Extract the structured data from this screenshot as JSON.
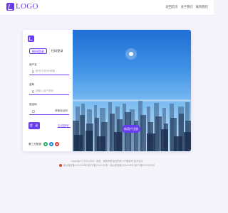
{
  "brand": {
    "logo_text": "LOGO",
    "accent": "#6a3cf0"
  },
  "topnav": {
    "items": [
      "返回首页",
      "关于我们",
      "联系我们"
    ]
  },
  "login": {
    "tabs": [
      {
        "label": "密码登录",
        "active": true
      },
      {
        "label": "扫码登录",
        "active": false
      }
    ],
    "username": {
      "label": "用户名",
      "placeholder": "账号/手机号/邮箱"
    },
    "password": {
      "label": "密码",
      "placeholder": "请输入用户密码"
    },
    "captcha": {
      "label": "验证码",
      "button": "获取验证码"
    },
    "submit_label": "登 录",
    "forgot_label": "忘记密码？",
    "third_party": {
      "label": "第三方登录",
      "icons": [
        {
          "name": "wechat-icon",
          "color": "#2aae67"
        },
        {
          "name": "qq-icon",
          "color": "#1e88e5"
        },
        {
          "name": "weibo-icon",
          "color": "#e53935"
        }
      ]
    }
  },
  "banner": {
    "register_label": "新用户注册"
  },
  "footer": {
    "line1": "Copyright © 2019-2023 · 版权 · 美篇声明 版权所有 ICP备案号 技术支持",
    "line2": "赣公网安备12110100号 赣ICP备12110100号 · 赣公网安备12110100号 赣ICP备12110100号"
  }
}
